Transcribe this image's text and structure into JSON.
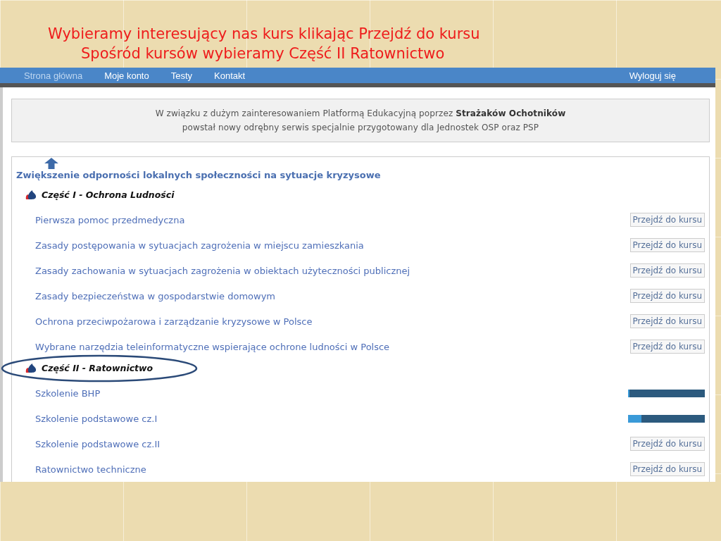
{
  "slide_title": {
    "texts": [
      "Wybieramy interesujący nas kurs klikając Przejdź do kursu",
      "Spośród kursów wybieramy Część II Ratownictwo"
    ]
  },
  "nav": {
    "items": [
      {
        "label": "Strona główna",
        "selected": true
      },
      {
        "label": "Moje konto",
        "selected": false
      },
      {
        "label": "Testy",
        "selected": false
      },
      {
        "label": "Kontakt",
        "selected": false
      }
    ],
    "logout": "Wyloguj się"
  },
  "notice": {
    "lines": [
      "W związku z dużym zainteresowaniem Platformą Edukacyjną poprzez **Strażaków Ochotników**",
      "powstał nowy odrębny serwis specjalnie przygotowany dla Jednostek OSP oraz PSP"
    ]
  },
  "program": {
    "title": "Zwiększenie odporności lokalnych społeczności na sytuacje kryzysowe",
    "parts": [
      {
        "title": "Część I - Ochrona Ludności",
        "courses": [
          {
            "name": "Pierwsza pomoc przedmedyczna",
            "kind": "button",
            "action": "Przejdź do kursu"
          },
          {
            "name": "Zasady postępowania w sytuacjach zagrożenia w miejscu zamieszkania",
            "kind": "button",
            "action": "Przejdź do kursu"
          },
          {
            "name": "Zasady zachowania w sytuacjach zagrożenia w obiektach użyteczności publicznej",
            "kind": "button",
            "action": "Przejdź do kursu"
          },
          {
            "name": "Zasady bezpieczeństwa w gospodarstwie domowym",
            "kind": "button",
            "action": "Przejdź do kursu"
          },
          {
            "name": "Ochrona przeciwpożarowa i zarządzanie kryzysowe w Polsce",
            "kind": "button",
            "action": "Przejdź do kursu"
          },
          {
            "name": "Wybrane narzędzia teleinformatyczne wspierające ochrone ludności w Polsce",
            "kind": "button",
            "action": "Przejdź do kursu"
          }
        ]
      },
      {
        "title": "Część II - Ratownictwo",
        "courses": [
          {
            "name": "Szkolenie BHP",
            "kind": "progress",
            "level": 0.01
          },
          {
            "name": "Szkolenie podstawowe cz.I",
            "kind": "progress",
            "level": 0.17
          },
          {
            "name": "Szkolenie podstawowe cz.II",
            "kind": "button",
            "action": "Przejdź do kursu"
          },
          {
            "name": "Ratownictwo techniczne",
            "kind": "button",
            "action": "Przejdź do kursu"
          }
        ]
      }
    ]
  }
}
